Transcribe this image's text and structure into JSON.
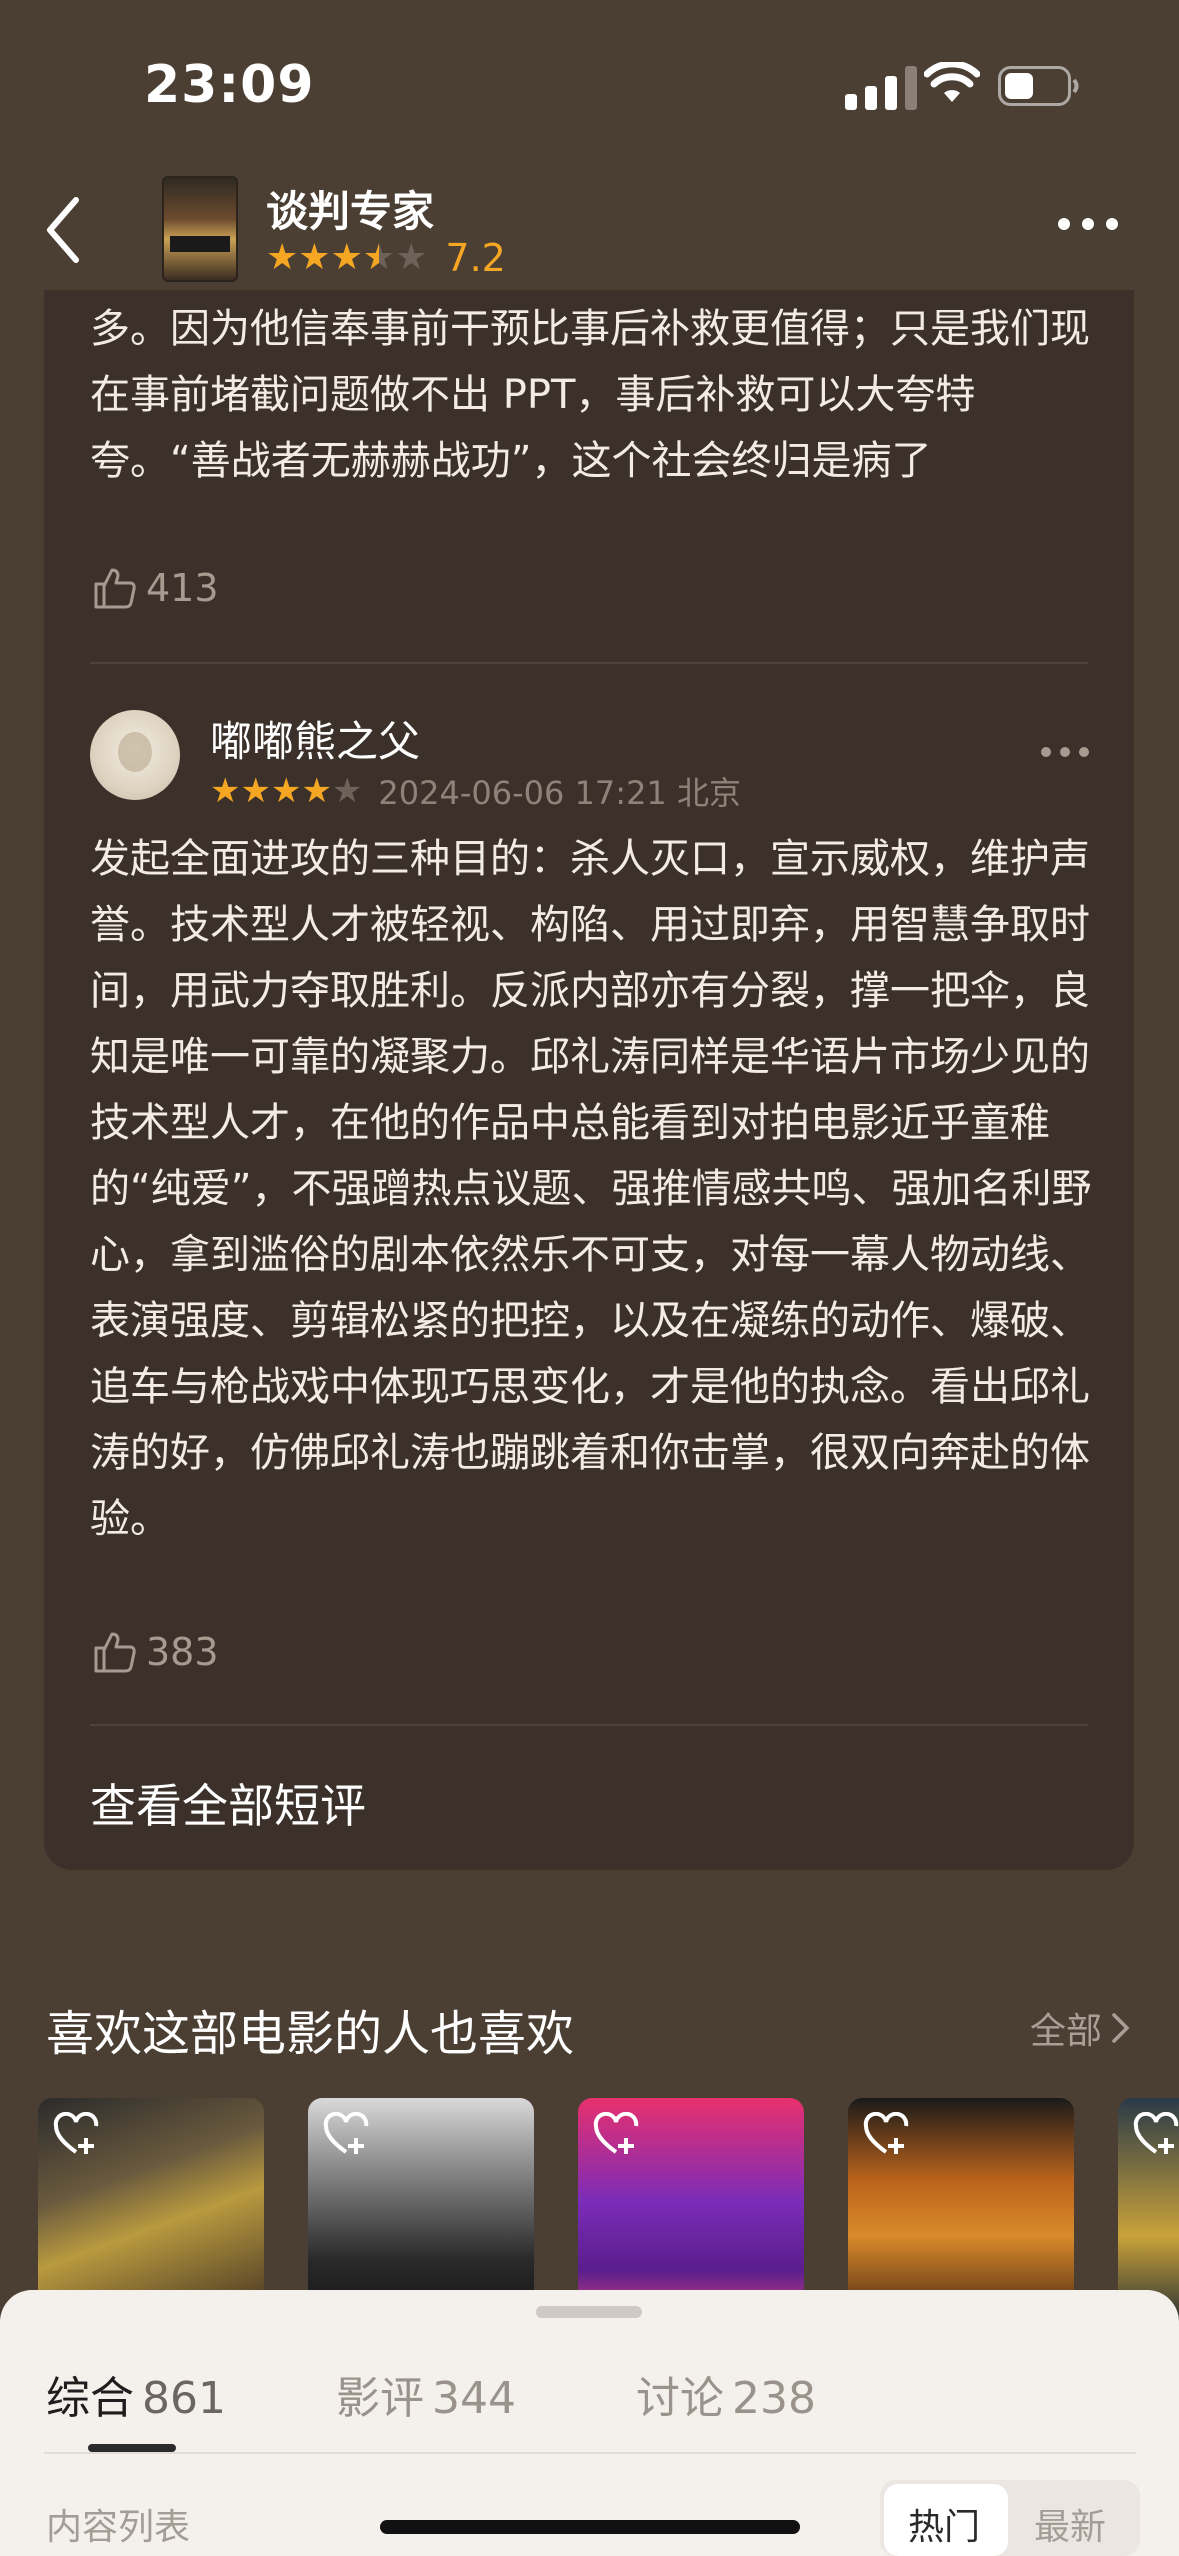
{
  "status_bar": {
    "time": "23:09"
  },
  "header": {
    "movie_title": "谈判专家",
    "rating_stars": 3.5,
    "score": "7.2",
    "accent_color": "#f5a623"
  },
  "reviews": [
    {
      "text": "多。因为他信奉事前干预比事后补救更值得；只是我们现在事前堵截问题做不出 PPT，事后补救可以大夸特夸。“善战者无赫赫战功”，这个社会终归是病了",
      "likes": "413"
    },
    {
      "author": "嘟嘟熊之父",
      "stars": 4,
      "date_location": "2024-06-06 17:21 北京",
      "text": "发起全面进攻的三种目的：杀人灭口，宣示威权，维护声誉。技术型人才被轻视、构陷、用过即弃，用智慧争取时间，用武力夺取胜利。反派内部亦有分裂，撑一把伞，良知是唯一可靠的凝聚力。邱礼涛同样是华语片市场少见的技术型人才，在他的作品中总能看到对拍电影近乎童稚的“纯爱”，不强蹭热点议题、强推情感共鸣、强加名利野心，拿到滥俗的剧本依然乐不可支，对每一幕人物动线、表演强度、剪辑松紧的把控，以及在凝练的动作、爆破、追车与枪战戏中体现巧思变化，才是他的执念。看出邱礼涛的好，仿佛邱礼涛也蹦跳着和你击掌，很双向奔赴的体验。",
      "likes": "383"
    }
  ],
  "see_all_label": "查看全部短评",
  "recommendations": {
    "title": "喜欢这部电影的人也喜欢",
    "all_label": "全部"
  },
  "sheet": {
    "tabs": [
      {
        "label": "综合",
        "count": "861"
      },
      {
        "label": "影评",
        "count": "344"
      },
      {
        "label": "讨论",
        "count": "238"
      }
    ],
    "content_list_label": "内容列表",
    "sort_options": [
      "热门",
      "最新"
    ]
  }
}
